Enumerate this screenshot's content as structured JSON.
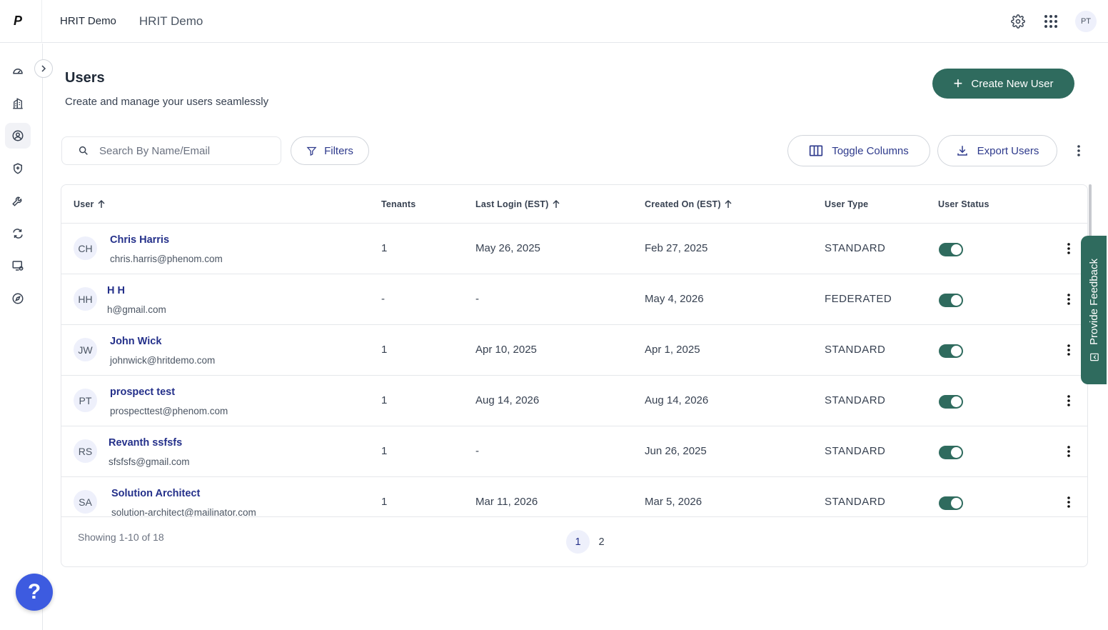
{
  "topbar": {
    "logo_text": "P",
    "org_name": "HRIT Demo",
    "app_name": "HRIT Demo",
    "avatar_initials": "PT",
    "icons": [
      "settings-icon",
      "apps-grid-icon"
    ]
  },
  "sidebar": {
    "items": [
      {
        "name": "dashboard-icon",
        "active": false
      },
      {
        "name": "building-icon",
        "active": false
      },
      {
        "name": "user-circle-icon",
        "active": true
      },
      {
        "name": "shield-icon",
        "active": false
      },
      {
        "name": "wrench-icon",
        "active": false
      },
      {
        "name": "sync-icon",
        "active": false
      },
      {
        "name": "monitor-settings-icon",
        "active": false
      },
      {
        "name": "compass-icon",
        "active": false
      }
    ],
    "help_label": "?"
  },
  "page": {
    "title": "Users",
    "subtitle": "Create and manage your users seamlessly",
    "create_button": "Create New User"
  },
  "toolbar": {
    "search_placeholder": "Search By Name/Email",
    "filters_label": "Filters",
    "toggle_columns_label": "Toggle Columns",
    "export_label": "Export Users"
  },
  "table": {
    "headers": {
      "user": "User",
      "tenants": "Tenants",
      "last_login": "Last Login (EST)",
      "created_on": "Created On (EST)",
      "user_type": "User Type",
      "user_status": "User Status"
    },
    "rows": [
      {
        "initials": "CH",
        "name": "Chris Harris",
        "email": "chris.harris@phenom.com",
        "tenants": "1",
        "last_login": "May 26, 2025",
        "created_on": "Feb 27, 2025",
        "user_type": "STANDARD",
        "status_on": true
      },
      {
        "initials": "HH",
        "name": "H H",
        "email": "h@gmail.com",
        "tenants": "-",
        "last_login": "-",
        "created_on": "May 4, 2026",
        "user_type": "FEDERATED",
        "status_on": true
      },
      {
        "initials": "JW",
        "name": "John Wick",
        "email": "johnwick@hritdemo.com",
        "tenants": "1",
        "last_login": "Apr 10, 2025",
        "created_on": "Apr 1, 2025",
        "user_type": "STANDARD",
        "status_on": true
      },
      {
        "initials": "PT",
        "name": "prospect test",
        "email": "prospecttest@phenom.com",
        "tenants": "1",
        "last_login": "Aug 14, 2026",
        "created_on": "Aug 14, 2026",
        "user_type": "STANDARD",
        "status_on": true
      },
      {
        "initials": "RS",
        "name": "Revanth ssfsfs",
        "email": "sfsfsfs@gmail.com",
        "tenants": "1",
        "last_login": "-",
        "created_on": "Jun 26, 2025",
        "user_type": "STANDARD",
        "status_on": true
      },
      {
        "initials": "SA",
        "name": "Solution Architect",
        "email": "solution-architect@mailinator.com",
        "tenants": "1",
        "last_login": "Mar 11, 2026",
        "created_on": "Mar 5, 2026",
        "user_type": "STANDARD",
        "status_on": true
      }
    ],
    "footer": {
      "showing": "Showing 1-10 of 18",
      "pages": [
        "1",
        "2"
      ],
      "current_page": "1"
    }
  },
  "feedback": {
    "label": "Provide Feedback"
  },
  "colors": {
    "primary_green": "#2f6b5e",
    "link_blue": "#24308a",
    "help_blue": "#3d5be0"
  }
}
